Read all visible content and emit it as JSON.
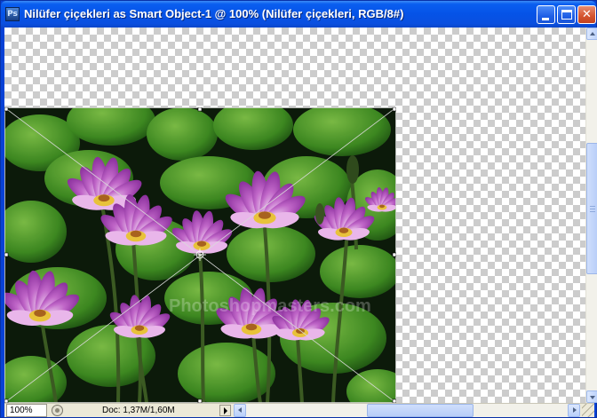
{
  "window": {
    "title": "Nilüfer çiçekleri as Smart Object-1 @ 100% (Nilüfer çiçekleri, RGB/8#)",
    "app_icon_text": "Ps",
    "buttons": [
      "minimize",
      "maximize",
      "close"
    ],
    "colors": {
      "titlebar": "#0553e7",
      "close_button": "#d4542f"
    }
  },
  "canvas": {
    "background": "transparency-checkerboard",
    "layer": "Nilüfer çiçekleri",
    "transform": "free-transform-box-with-diagonals",
    "watermark": "Photoshopmasters.com"
  },
  "status_bar": {
    "zoom": "100%",
    "doc_info": "Doc: 1,37M/1,60M"
  }
}
